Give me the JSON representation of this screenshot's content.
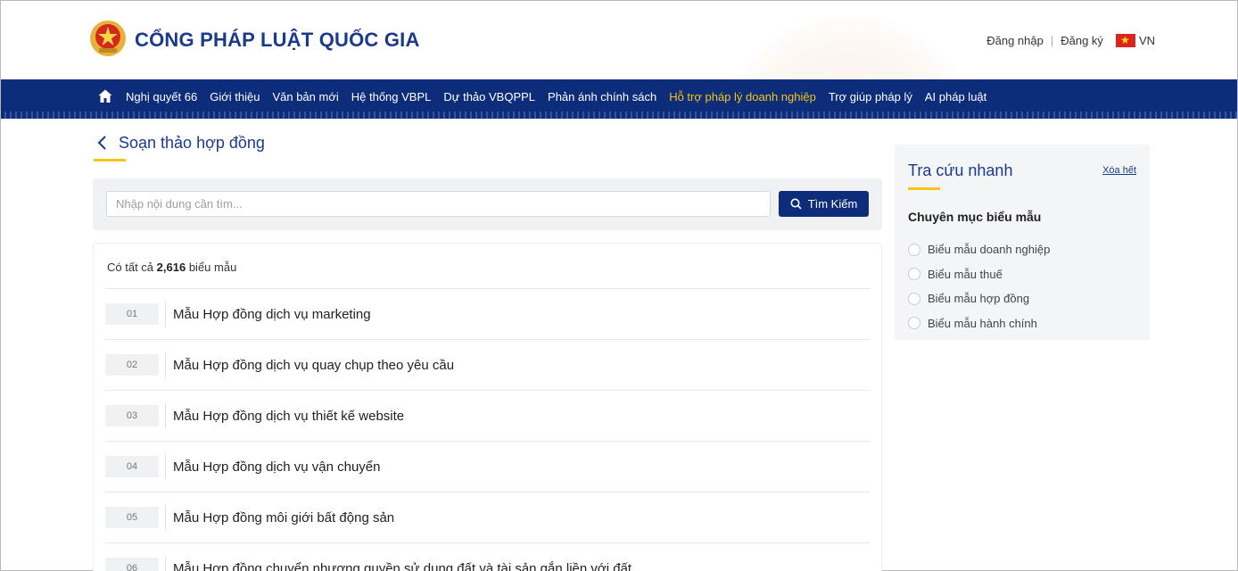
{
  "header": {
    "site_title": "CỔNG PHÁP LUẬT QUỐC GIA",
    "login": "Đăng nhập",
    "register": "Đăng ký",
    "language": "VN",
    "logo_icon": "national-emblem-icon"
  },
  "nav": {
    "items": [
      {
        "label": "Nghị quyết 66",
        "active": false
      },
      {
        "label": "Giới thiệu",
        "active": false
      },
      {
        "label": "Văn bản mới",
        "active": false
      },
      {
        "label": "Hệ thống VBPL",
        "active": false
      },
      {
        "label": "Dự thảo VBQPPL",
        "active": false
      },
      {
        "label": "Phản ánh chính sách",
        "active": false
      },
      {
        "label": "Hỗ trợ pháp lý doanh nghiệp",
        "active": true
      },
      {
        "label": "Trợ giúp pháp lý",
        "active": false
      },
      {
        "label": "AI pháp luật",
        "active": false
      }
    ],
    "active_color": "#f5c518",
    "background": "#0d2d7b"
  },
  "page": {
    "title": "Soạn thảo hợp đồng"
  },
  "search": {
    "placeholder": "Nhập nội dung cần tìm...",
    "value": "",
    "button_label": "Tìm Kiếm"
  },
  "results": {
    "count_prefix": "Có tất cả",
    "count": "2,616",
    "count_suffix": "biểu mẫu",
    "items": [
      {
        "num": "01",
        "title": "Mẫu Hợp đồng dịch vụ marketing"
      },
      {
        "num": "02",
        "title": "Mẫu Hợp đồng dịch vụ quay chụp theo yêu cầu"
      },
      {
        "num": "03",
        "title": "Mẫu Hợp đồng dịch vụ thiết kế website"
      },
      {
        "num": "04",
        "title": "Mẫu Hợp đồng dịch vụ vận chuyển"
      },
      {
        "num": "05",
        "title": "Mẫu Hợp đồng môi giới bất động sản"
      },
      {
        "num": "06",
        "title": "Mẫu Hợp đồng chuyển nhượng quyền sử dụng đất và tài sản gắn liền với đất"
      }
    ]
  },
  "sidebar": {
    "title": "Tra cứu nhanh",
    "clear_label": "Xóa hết",
    "section_title": "Chuyên mục biểu mẫu",
    "options": [
      {
        "label": "Biểu mẫu doanh nghiệp",
        "checked": false
      },
      {
        "label": "Biểu mẫu thuế",
        "checked": false
      },
      {
        "label": "Biểu mẫu hợp đồng",
        "checked": false
      },
      {
        "label": "Biểu mẫu hành chính",
        "checked": false
      }
    ]
  }
}
